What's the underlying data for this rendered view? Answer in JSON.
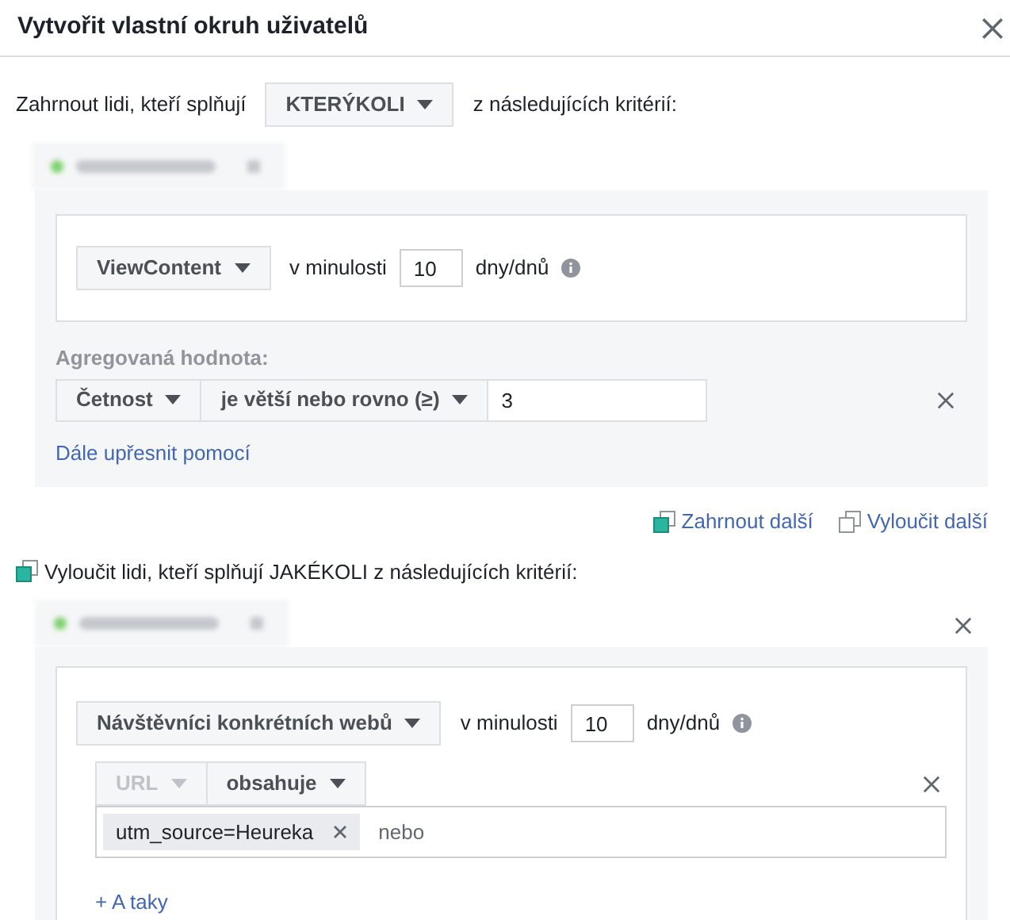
{
  "dialog": {
    "title": "Vytvořit vlastní okruh uživatelů"
  },
  "include": {
    "prefix": "Zahrnout lidi, kteří splňují",
    "match": "KTERÝKOLI",
    "suffix": "z následujících kritérií:",
    "rule": {
      "event": "ViewContent",
      "in_last": "v minulosti",
      "days": "10",
      "unit": "dny/dnů"
    },
    "aggregate": {
      "label": "Agregovaná hodnota:",
      "metric": "Četnost",
      "operator": "je větší nebo rovno (≥)",
      "value": "3"
    },
    "refine_link": "Dále upřesnit pomocí"
  },
  "actions": [
    {
      "label": "Zahrnout další",
      "kind": "include"
    },
    {
      "label": "Vyloučit další",
      "kind": "exclude"
    }
  ],
  "exclude": {
    "text": "Vyloučit lidi, kteří splňují JAKÉKOLI z následujících kritérií:",
    "rule": {
      "event": "Návštěvníci konkrétních webů",
      "in_last": "v minulosti",
      "days": "10",
      "unit": "dny/dnů"
    },
    "filter": {
      "field": "URL",
      "field_disabled": true,
      "operator": "obsahuje",
      "tags": [
        "utm_source=Heureka"
      ],
      "placeholder": "nebo"
    },
    "and_link": "+ A taky"
  }
}
